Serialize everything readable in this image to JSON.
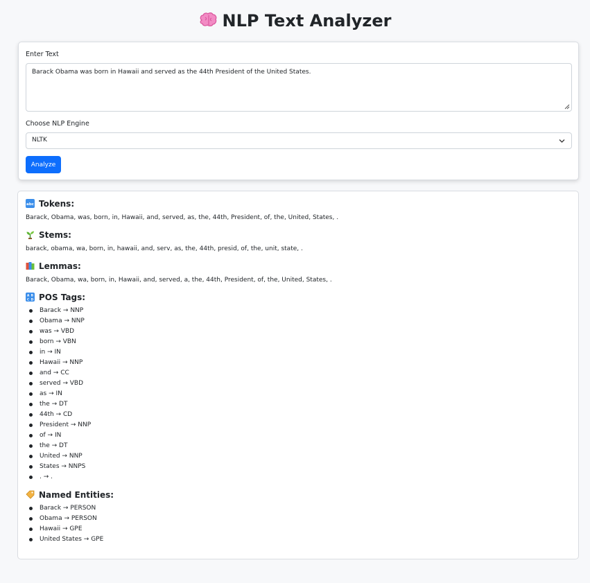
{
  "app": {
    "title": "NLP Text Analyzer",
    "title_icon": "brain-icon"
  },
  "form": {
    "text_label": "Enter Text",
    "text_value": "Barack Obama was born in Hawaii and served as the 44th President of the United States.",
    "engine_label": "Choose NLP Engine",
    "engine_selected": "NLTK",
    "analyze_label": "Analyze",
    "accent_color": "#0d6efd"
  },
  "results": {
    "tokens": {
      "heading": "Tokens:",
      "icon": "abc-icon",
      "text": "Barack, Obama, was, born, in, Hawaii, and, served, as, the, 44th, President, of, the, United, States, ."
    },
    "stems": {
      "heading": "Stems:",
      "icon": "seedling-icon",
      "text": "barack, obama, wa, born, in, hawaii, and, serv, as, the, 44th, presid, of, the, unit, state, ."
    },
    "lemmas": {
      "heading": "Lemmas:",
      "icon": "books-icon",
      "text": "Barack, Obama, wa, born, in, Hawaii, and, served, a, the, 44th, President, of, the, United, States, ."
    },
    "pos": {
      "heading": "POS Tags:",
      "icon": "symbols-icon",
      "items": [
        "Barack → NNP",
        "Obama → NNP",
        "was → VBD",
        "born → VBN",
        "in → IN",
        "Hawaii → NNP",
        "and → CC",
        "served → VBD",
        "as → IN",
        "the → DT",
        "44th → CD",
        "President → NNP",
        "of → IN",
        "the → DT",
        "United → NNP",
        "States → NNPS",
        ". → ."
      ]
    },
    "entities": {
      "heading": "Named Entities:",
      "icon": "label-tag-icon",
      "items": [
        "Barack → PERSON",
        "Obama → PERSON",
        "Hawaii → GPE",
        "United States → GPE"
      ]
    }
  }
}
